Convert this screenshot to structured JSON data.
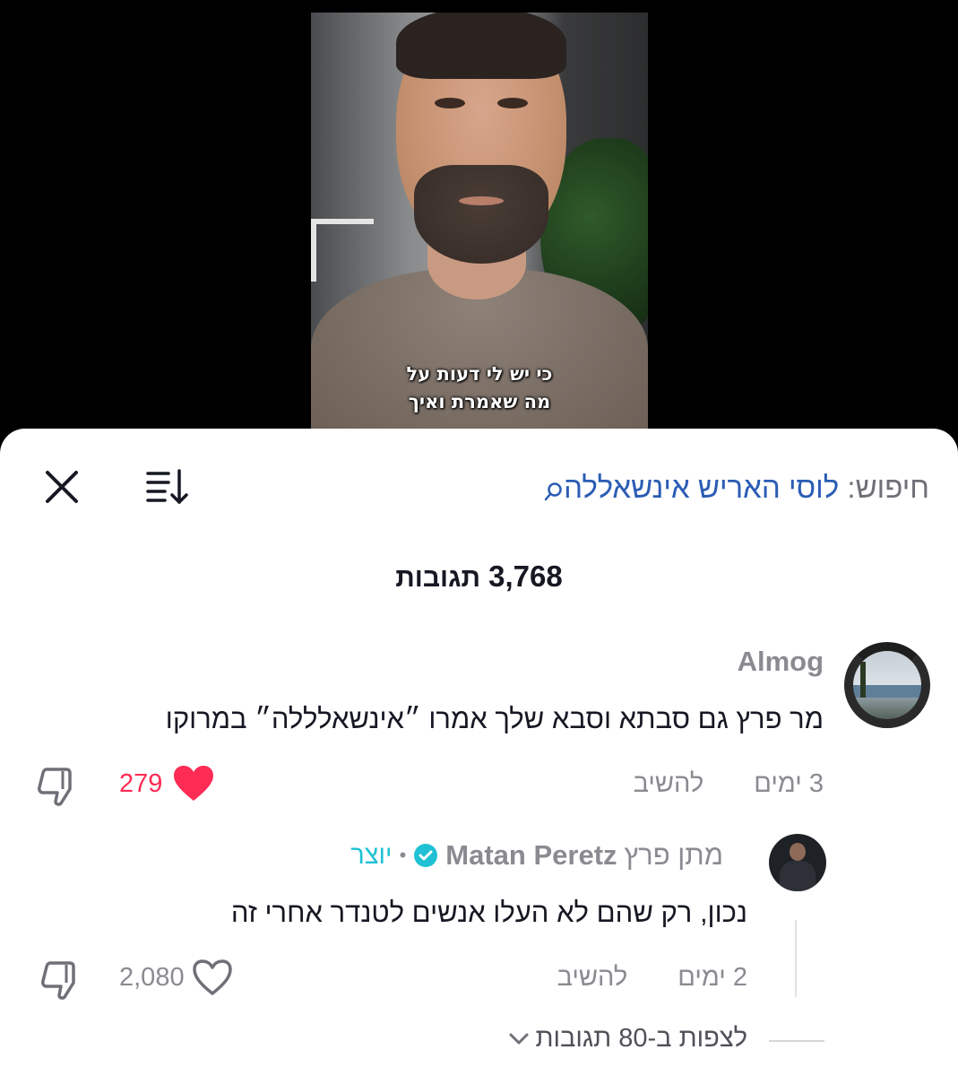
{
  "video": {
    "caption_line1": "כי יש לי דעות על",
    "caption_line2": "מה שאמרת ואיך"
  },
  "header": {
    "search_prefix": "חיפוש:",
    "search_query": "לוסי האריש אינשאללה",
    "close_icon": "close-icon",
    "sort_icon": "sort-icon"
  },
  "comments_count": {
    "number": "3,768",
    "label": "תגובות"
  },
  "comment": {
    "author": "Almog",
    "text": "מר פרץ גם סבתא וסבא שלך אמרו ״אינשאלללה״ במרוקו",
    "time": "3 ימים",
    "reply_label": "להשיב",
    "likes": "279",
    "liked": true,
    "like_color": "#fe2c55"
  },
  "reply": {
    "author_hebrew": "מתן פרץ",
    "author_latin": "Matan Peretz",
    "creator_badge": "יוצר",
    "text": "נכון, רק שהם לא העלו אנשים לטנדר אחרי זה",
    "time": "2 ימים",
    "reply_label": "להשיב",
    "likes": "2,080",
    "liked": false,
    "creator_color": "#20c1d4"
  },
  "view_more": {
    "label": "לצפות ב-80 תגובות"
  }
}
